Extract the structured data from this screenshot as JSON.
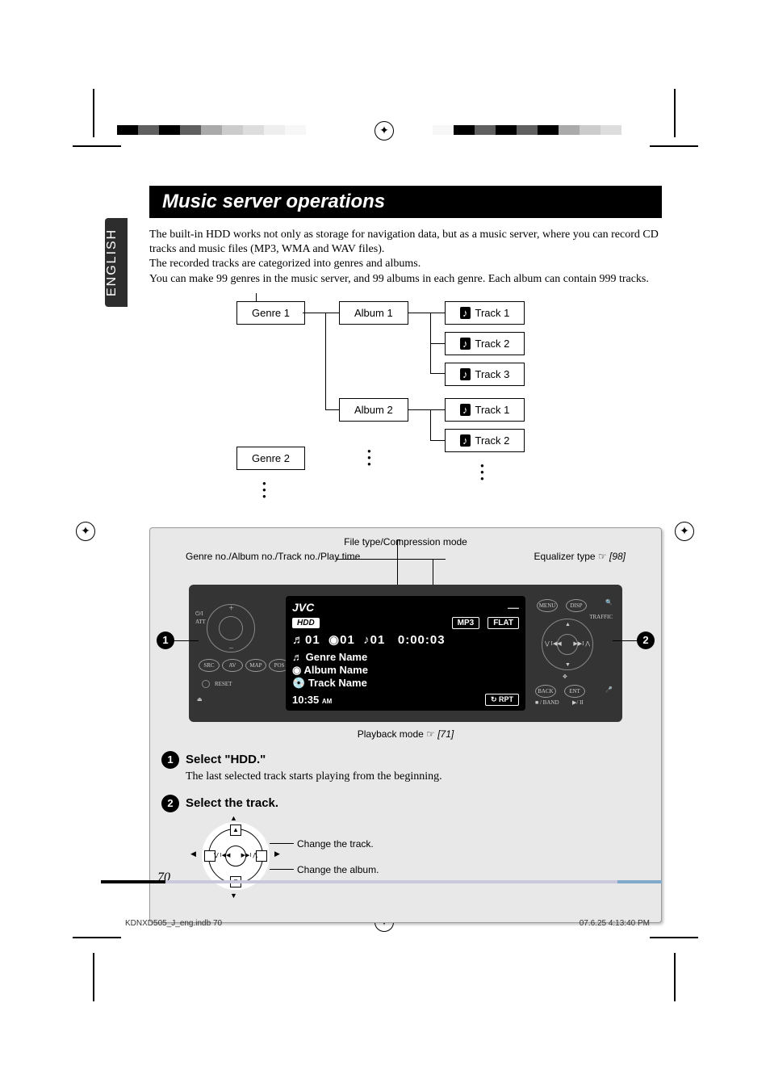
{
  "lang_tab": "ENGLISH",
  "title": "Music server operations",
  "para": [
    "The built-in HDD works not only as storage for navigation data, but as a music server, where you can record CD tracks and music files (MP3, WMA and WAV files).",
    "The recorded tracks are categorized into genres and albums.",
    "You can make 99 genres in the music server, and 99 albums in each genre. Each album can contain 999 tracks."
  ],
  "diagram": {
    "genre1": "Genre 1",
    "genre2": "Genre 2",
    "album1": "Album 1",
    "album2": "Album 2",
    "track1": "Track 1",
    "track2": "Track 2",
    "track3": "Track 3",
    "t2_1": "Track 1",
    "t2_2": "Track 2",
    "note_icon": "♪"
  },
  "panel": {
    "top_center": "File type/Compression mode",
    "left_label": "Genre no./Album no./Track no./Play time",
    "right_label": "Equalizer type ☞ ",
    "right_ref": "[98]",
    "bottom_label": "Playback mode ☞ ",
    "bottom_ref": "[71]",
    "bubble1": "1",
    "bubble2": "2"
  },
  "screen": {
    "brand": "JVC",
    "hdd": "HDD",
    "mp3": "MP3",
    "flat": "FLAT",
    "genre_no": "01",
    "album_no": "01",
    "track_no": "01",
    "playtime": "0:00:03",
    "genre_name": "Genre Name",
    "album_name": "Album Name",
    "track_name": "Track Name",
    "rpt": "RPT",
    "clock": "10:35",
    "ampm": "AM"
  },
  "left_buttons": {
    "att": "ATT",
    "src": "SRC",
    "av": "AV",
    "map": "MAP",
    "pos": "POS",
    "reset": "RESET"
  },
  "right_buttons": {
    "menu": "MENU",
    "disp": "DISP",
    "traffic": "TRAFFIC",
    "back": "BACK",
    "ent": "ENT",
    "band": "■ / BAND",
    "play": "▶/ II",
    "voice": "VOICE"
  },
  "steps": {
    "s1_head": "Select \"HDD.\"",
    "s1_body": "The last selected track starts playing from the beginning.",
    "s2_head": "Select the track.",
    "change_track": "Change the track.",
    "change_album": "Change the album."
  },
  "glyphs": {
    "genre": "♬",
    "album": "◉",
    "note": "♪",
    "disc": "💿",
    "move": "✥",
    "search": "🔍",
    "eject": "⏏"
  },
  "page_number": "70",
  "footer_left": "KDNXD505_J_eng.indb   70",
  "footer_right": "07.6.25   4:13:40 PM"
}
